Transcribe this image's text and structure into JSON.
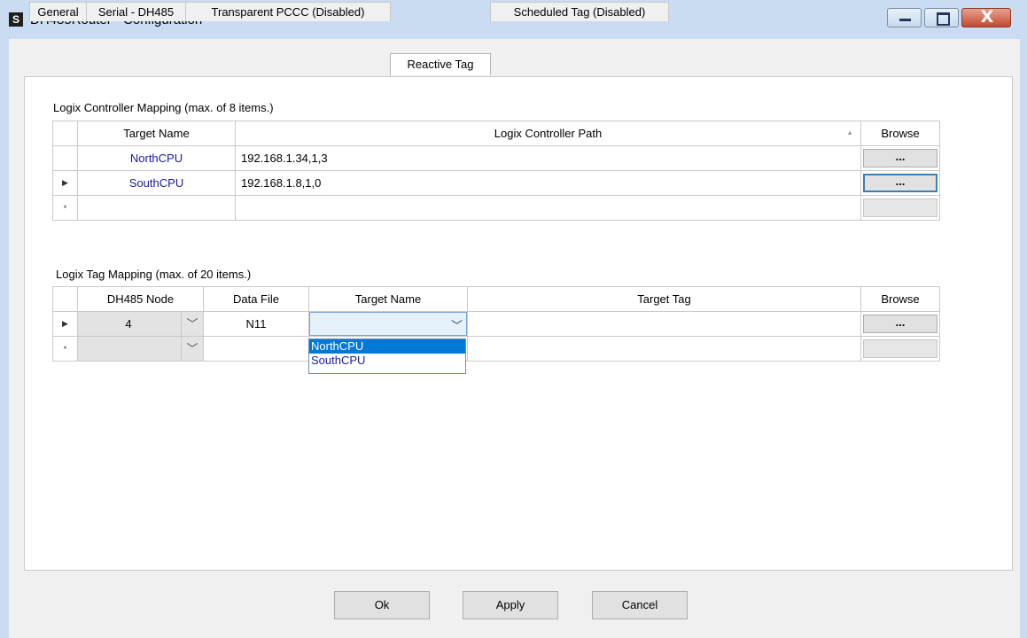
{
  "window": {
    "app_icon_glyph": "S",
    "title": "DH485Router - Configuration",
    "controls": {
      "minimize_icon": "minimize-icon",
      "maximize_icon": "maximize-icon",
      "close_glyph": "X"
    }
  },
  "tabs": [
    {
      "label": "General",
      "active": false
    },
    {
      "label": "Serial - DH485",
      "active": false
    },
    {
      "label": "Transparent PCCC (Disabled)",
      "active": false
    },
    {
      "label": "Reactive Tag",
      "active": true
    },
    {
      "label": "Scheduled Tag (Disabled)",
      "active": false
    }
  ],
  "controller_mapping": {
    "label": "Logix Controller Mapping (max. of 8 items.)",
    "columns": [
      "Target Name",
      "Logix Controller Path",
      "Browse"
    ],
    "sort_indicator": "▲",
    "rows": [
      {
        "marker": "",
        "target_name": "NorthCPU",
        "path": "192.168.1.34,1,3",
        "browse": "..."
      },
      {
        "marker": "▶",
        "target_name": "SouthCPU",
        "path": "192.168.1.8,1,0",
        "browse": "..."
      }
    ],
    "new_row_marker": "*"
  },
  "tag_mapping": {
    "label": "Logix Tag Mapping (max. of 20 items.)",
    "columns": [
      "DH485 Node",
      "Data File",
      "Target Name",
      "Target Tag",
      "Browse"
    ],
    "rows": [
      {
        "marker": "▶",
        "node": "4",
        "data_file": "N11",
        "target_name": "",
        "target_tag": "",
        "browse": "..."
      }
    ],
    "new_row_marker": "*",
    "dropdown_arrow": "﹀"
  },
  "dropdown": {
    "options": [
      "NorthCPU",
      "SouthCPU"
    ],
    "selected_index": 0
  },
  "footer": {
    "ok": "Ok",
    "apply": "Apply",
    "cancel": "Cancel"
  },
  "colors": {
    "title_bar": "#c9dcf1",
    "link_text": "#1a1a9e",
    "selection": "#0078d7",
    "close_button": "#c24a33"
  }
}
